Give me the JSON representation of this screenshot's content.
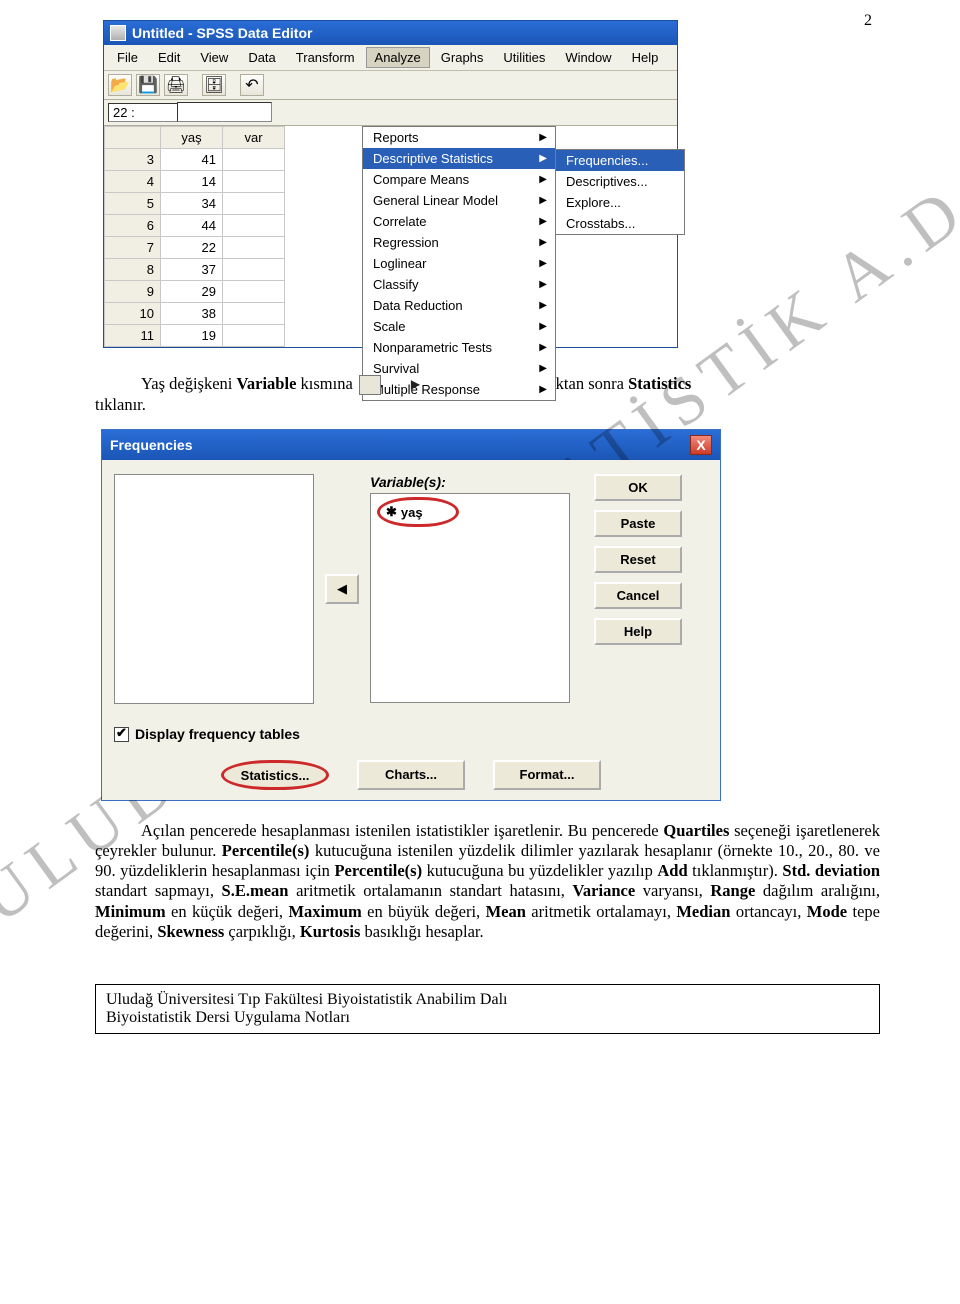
{
  "page": {
    "number": "2"
  },
  "watermark": "ULUDAĞ   BİYOİSTATİSTİK A.D.",
  "spss": {
    "title": "Untitled - SPSS Data Editor",
    "menus": [
      "File",
      "Edit",
      "View",
      "Data",
      "Transform",
      "Analyze",
      "Graphs",
      "Utilities",
      "Window",
      "Help"
    ],
    "active_menu_index": 5,
    "cell_ref": "22 :",
    "col_headers": [
      "",
      "yaş",
      "var"
    ],
    "rows": [
      [
        "3",
        "41"
      ],
      [
        "4",
        "14"
      ],
      [
        "5",
        "34"
      ],
      [
        "6",
        "44"
      ],
      [
        "7",
        "22"
      ],
      [
        "8",
        "37"
      ],
      [
        "9",
        "29"
      ],
      [
        "10",
        "38"
      ],
      [
        "11",
        "19"
      ]
    ],
    "analyze_menu": [
      "Reports",
      "Descriptive Statistics",
      "Compare Means",
      "General Linear Model",
      "Correlate",
      "Regression",
      "Loglinear",
      "Classify",
      "Data Reduction",
      "Scale",
      "Nonparametric Tests",
      "Survival",
      "Multiple Response"
    ],
    "analyze_selected_index": 1,
    "desc_menu": [
      "Frequencies...",
      "Descriptives...",
      "Explore...",
      "Crosstabs..."
    ],
    "desc_selected_index": 0,
    "trailing_col_header": "va"
  },
  "body_text": {
    "line1a": "Yaş değişkeni ",
    "line1b": "Variable",
    "line1c": " kısmına ",
    "line1d": " simgesi tıklanarak taşındıktan sonra ",
    "line1e": "Statistics",
    "line2": "tıklanır."
  },
  "freq": {
    "title": "Frequencies",
    "var_label": "Variable(s):",
    "var_item": "yaş",
    "buttons": [
      "OK",
      "Paste",
      "Reset",
      "Cancel",
      "Help"
    ],
    "chk_label": "Display frequency tables",
    "bottom": [
      "Statistics...",
      "Charts...",
      "Format..."
    ]
  },
  "para": {
    "t1": "Açılan pencerede hesaplanması istenilen istatistikler işaretlenir. Bu pencerede ",
    "t2": "Quartiles",
    "t3": " seçeneği işaretlenerek çeyrekler bulunur. ",
    "t4": "Percentile(s)",
    "t5": " kutucuğuna istenilen yüzdelik dilimler yazılarak hesaplanır (örnekte 10., 20., 80. ve 90. yüzdeliklerin hesaplanması için ",
    "t6": "Percentile(s)",
    "t7": " kutucuğuna bu yüzdelikler yazılıp ",
    "t8": "Add",
    "t9": " tıklanmıştır). ",
    "t10": "Std. deviation",
    "t11": " standart sapmayı, ",
    "t12": "S.E.mean",
    "t13": " aritmetik ortalamanın standart hatasını, ",
    "t14": "Variance",
    "t15": " varyansı, ",
    "t16": "Range",
    "t17": " dağılım aralığını, ",
    "t18": "Minimum",
    "t19": " en küçük değeri, ",
    "t20": "Maximum",
    "t21": " en büyük değeri, ",
    "t22": "Mean",
    "t23": " aritmetik ortalamayı, ",
    "t24": "Median",
    "t25": " ortancayı, ",
    "t26": "Mode",
    "t27": " tepe değerini, ",
    "t28": "Skewness",
    "t29": " çarpıklığı, ",
    "t30": "Kurtosis",
    "t31": " basıklığı hesaplar."
  },
  "footer": {
    "l1": "Uludağ Üniversitesi Tıp Fakültesi Biyoistatistik Anabilim Dalı",
    "l2": "Biyoistatistik Dersi Uygulama Notları"
  }
}
